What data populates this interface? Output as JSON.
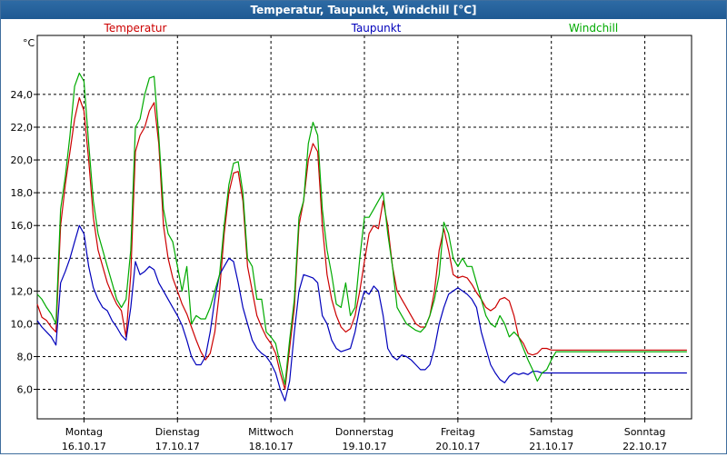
{
  "window": {
    "title": "Temperatur, Taupunkt, Windchill [°C]"
  },
  "chart_data": {
    "type": "line",
    "title": "Temperatur, Taupunkt, Windchill [°C]",
    "ylabel": "°C",
    "xlabel": "",
    "ylim": [
      4.2,
      27.6
    ],
    "xlim": [
      0,
      7
    ],
    "grid": true,
    "yticks": [
      6,
      8,
      10,
      12,
      14,
      16,
      18,
      20,
      22,
      24
    ],
    "ytick_labels": [
      "6,0",
      "8,0",
      "10,0",
      "12,0",
      "14,0",
      "16,0",
      "18,0",
      "20,0",
      "22,0",
      "24,0"
    ],
    "x_days": [
      {
        "day": "Montag",
        "date": "16.10.17"
      },
      {
        "day": "Dienstag",
        "date": "17.10.17"
      },
      {
        "day": "Mittwoch",
        "date": "18.10.17"
      },
      {
        "day": "Donnerstag",
        "date": "19.10.17"
      },
      {
        "day": "Freitag",
        "date": "20.10.17"
      },
      {
        "day": "Samstag",
        "date": "21.10.17"
      },
      {
        "day": "Sonntag",
        "date": "22.10.17"
      }
    ],
    "legend_placement": "top",
    "series": [
      {
        "name": "Temperatur",
        "color": "#cc0000",
        "x": [
          0,
          0.05,
          0.1,
          0.15,
          0.2,
          0.25,
          0.3,
          0.35,
          0.4,
          0.45,
          0.5,
          0.55,
          0.6,
          0.65,
          0.7,
          0.75,
          0.8,
          0.85,
          0.9,
          0.95,
          1,
          1.05,
          1.1,
          1.15,
          1.2,
          1.25,
          1.3,
          1.35,
          1.4,
          1.45,
          1.5,
          1.55,
          1.6,
          1.65,
          1.7,
          1.75,
          1.8,
          1.85,
          1.9,
          1.95,
          2,
          2.05,
          2.1,
          2.15,
          2.2,
          2.25,
          2.3,
          2.35,
          2.4,
          2.45,
          2.5,
          2.55,
          2.6,
          2.65,
          2.7,
          2.75,
          2.8,
          2.85,
          2.9,
          2.95,
          3,
          3.05,
          3.1,
          3.15,
          3.2,
          3.25,
          3.3,
          3.35,
          3.4,
          3.45,
          3.5,
          3.55,
          3.6,
          3.65,
          3.7,
          3.75,
          3.8,
          3.85,
          3.9,
          3.95,
          4,
          4.05,
          4.1,
          4.15,
          4.2,
          4.25,
          4.3,
          4.35,
          4.4,
          4.45,
          4.5,
          4.55,
          4.6,
          4.65,
          4.7,
          4.75,
          4.8,
          4.85,
          4.9,
          4.95,
          5,
          5.05,
          5.1,
          5.15,
          5.2,
          5.25,
          5.3,
          5.35,
          5.4,
          5.45,
          5.5,
          5.55,
          5.6,
          5.65,
          5.7,
          5.75,
          5.8,
          5.85,
          5.9,
          5.95,
          6,
          6.05,
          6.1,
          6.15,
          6.2,
          6.25,
          6.3,
          6.35,
          6.4,
          6.45,
          6.5,
          6.55,
          6.6,
          6.65,
          6.7,
          6.75,
          6.8,
          6.85,
          6.9,
          6.95
        ],
        "values": [
          11.2,
          10.4,
          10.2,
          9.8,
          9.5,
          16,
          18.5,
          20.5,
          22.5,
          23.8,
          23,
          20,
          16.5,
          14.5,
          13.5,
          12.5,
          11.8,
          11.2,
          10.8,
          9.2,
          13,
          20.5,
          21.5,
          22,
          23,
          23.5,
          21,
          16,
          14,
          12.8,
          12,
          11.2,
          10.6,
          9.8,
          9,
          8.3,
          7.8,
          8.2,
          9.5,
          12,
          15.5,
          18,
          19.2,
          19.3,
          17.5,
          13.5,
          12,
          10.5,
          9.8,
          9.2,
          8.8,
          8.2,
          7,
          6,
          8.5,
          11,
          16,
          17.5,
          20,
          21,
          20.5,
          16,
          13,
          11.5,
          10.5,
          9.8,
          9.5,
          9.7,
          10.5,
          12,
          13.8,
          15.5,
          16,
          15.8,
          17.5,
          16,
          13.5,
          12,
          11.5,
          11,
          10.5,
          10,
          9.8,
          9.8,
          10.5,
          12,
          14.5,
          15.8,
          14.5,
          13,
          12.8,
          12.9,
          12.8,
          12.4,
          11.9,
          11.5,
          11,
          10.8,
          11,
          11.5,
          11.6,
          11.4,
          10.5,
          9.2,
          8.8,
          8.2,
          8.1,
          8.2,
          8.5,
          8.5,
          8.4,
          8.4,
          8.4,
          8.4,
          8.4,
          8.4,
          8.4,
          8.4,
          8.4,
          8.4,
          8.4,
          8.4,
          8.4,
          8.4,
          8.4,
          8.4,
          8.4,
          8.4,
          8.4,
          8.4,
          8.4,
          8.4,
          8.4,
          8.4,
          8.4,
          8.4,
          8.4,
          8.4,
          8.4,
          8.4
        ]
      },
      {
        "name": "Taupunkt",
        "color": "#0000bb",
        "x": [
          0,
          0.05,
          0.1,
          0.15,
          0.2,
          0.25,
          0.3,
          0.35,
          0.4,
          0.45,
          0.5,
          0.55,
          0.6,
          0.65,
          0.7,
          0.75,
          0.8,
          0.85,
          0.9,
          0.95,
          1,
          1.05,
          1.1,
          1.15,
          1.2,
          1.25,
          1.3,
          1.35,
          1.4,
          1.45,
          1.5,
          1.55,
          1.6,
          1.65,
          1.7,
          1.75,
          1.8,
          1.85,
          1.9,
          1.95,
          2,
          2.05,
          2.1,
          2.15,
          2.2,
          2.25,
          2.3,
          2.35,
          2.4,
          2.45,
          2.5,
          2.55,
          2.6,
          2.65,
          2.7,
          2.75,
          2.8,
          2.85,
          2.9,
          2.95,
          3,
          3.05,
          3.1,
          3.15,
          3.2,
          3.25,
          3.3,
          3.35,
          3.4,
          3.45,
          3.5,
          3.55,
          3.6,
          3.65,
          3.7,
          3.75,
          3.8,
          3.85,
          3.9,
          3.95,
          4,
          4.05,
          4.1,
          4.15,
          4.2,
          4.25,
          4.3,
          4.35,
          4.4,
          4.45,
          4.5,
          4.55,
          4.6,
          4.65,
          4.7,
          4.75,
          4.8,
          4.85,
          4.9,
          4.95,
          5,
          5.05,
          5.1,
          5.15,
          5.2,
          5.25,
          5.3,
          5.35,
          5.4,
          5.45,
          5.5,
          5.55,
          5.6,
          5.65,
          5.7,
          5.75,
          5.8,
          5.85,
          5.9,
          5.95,
          6,
          6.05,
          6.1,
          6.15,
          6.2,
          6.25,
          6.3,
          6.35,
          6.4,
          6.45,
          6.5,
          6.55,
          6.6,
          6.65,
          6.7,
          6.75,
          6.8,
          6.85,
          6.9,
          6.95
        ],
        "values": [
          10.2,
          9.8,
          9.5,
          9.2,
          8.7,
          12.5,
          13.2,
          14,
          15,
          16,
          15.5,
          13.5,
          12.2,
          11.5,
          11,
          10.8,
          10.2,
          9.8,
          9.3,
          9,
          11,
          13.8,
          13,
          13.2,
          13.5,
          13.3,
          12.5,
          12,
          11.5,
          11,
          10.5,
          9.9,
          9,
          8,
          7.5,
          7.5,
          8,
          9.5,
          11.5,
          13,
          13.5,
          14,
          13.8,
          12.5,
          11,
          10,
          9,
          8.5,
          8.2,
          8,
          7.6,
          7,
          6,
          5.3,
          6.5,
          9.5,
          12,
          13,
          12.9,
          12.8,
          12.5,
          10.5,
          10,
          9,
          8.5,
          8.3,
          8.4,
          8.5,
          9.5,
          11,
          12,
          11.8,
          12.3,
          12,
          10.5,
          8.5,
          8,
          7.8,
          8.1,
          8,
          7.8,
          7.5,
          7.2,
          7.2,
          7.5,
          8.5,
          10,
          11,
          11.8,
          12,
          12.2,
          12,
          11.8,
          11.5,
          11,
          9.5,
          8.5,
          7.5,
          7,
          6.6,
          6.4,
          6.8,
          7,
          6.9,
          7,
          6.9,
          7.1,
          7.1,
          7,
          7,
          7,
          7,
          7,
          7,
          7,
          7,
          7,
          7,
          7,
          7,
          7,
          7,
          7,
          7,
          7,
          7,
          7,
          7,
          7,
          7,
          7,
          7,
          7,
          7,
          7,
          7,
          7,
          7,
          7,
          7
        ]
      },
      {
        "name": "Windchill",
        "color": "#00aa00",
        "x": [
          0,
          0.05,
          0.1,
          0.15,
          0.2,
          0.25,
          0.3,
          0.35,
          0.4,
          0.45,
          0.5,
          0.55,
          0.6,
          0.65,
          0.7,
          0.75,
          0.8,
          0.85,
          0.9,
          0.95,
          1,
          1.05,
          1.1,
          1.15,
          1.2,
          1.25,
          1.3,
          1.35,
          1.4,
          1.45,
          1.5,
          1.55,
          1.6,
          1.65,
          1.7,
          1.75,
          1.8,
          1.85,
          1.9,
          1.95,
          2,
          2.05,
          2.1,
          2.15,
          2.2,
          2.25,
          2.3,
          2.35,
          2.4,
          2.45,
          2.5,
          2.55,
          2.6,
          2.65,
          2.7,
          2.75,
          2.8,
          2.85,
          2.9,
          2.95,
          3,
          3.05,
          3.1,
          3.15,
          3.2,
          3.25,
          3.3,
          3.35,
          3.4,
          3.45,
          3.5,
          3.55,
          3.6,
          3.65,
          3.7,
          3.75,
          3.8,
          3.85,
          3.9,
          3.95,
          4,
          4.05,
          4.1,
          4.15,
          4.2,
          4.25,
          4.3,
          4.35,
          4.4,
          4.45,
          4.5,
          4.55,
          4.6,
          4.65,
          4.7,
          4.75,
          4.8,
          4.85,
          4.9,
          4.95,
          5,
          5.05,
          5.1,
          5.15,
          5.2,
          5.25,
          5.3,
          5.35,
          5.4,
          5.45,
          5.5,
          5.55,
          5.6,
          5.65,
          5.7,
          5.75,
          5.8,
          5.85,
          5.9,
          5.95,
          6,
          6.05,
          6.1,
          6.15,
          6.2,
          6.25,
          6.3,
          6.35,
          6.4,
          6.45,
          6.5,
          6.55,
          6.6,
          6.65,
          6.7,
          6.75,
          6.8,
          6.85,
          6.9,
          6.95
        ],
        "values": [
          11.8,
          11.5,
          11,
          10.6,
          10,
          17,
          19,
          21.5,
          24.5,
          25.3,
          24.8,
          21,
          17.5,
          15.5,
          14.5,
          13.5,
          12.5,
          11.5,
          11,
          11.5,
          14.5,
          22,
          22.5,
          24,
          25,
          25.1,
          21.5,
          17,
          15.5,
          15,
          13.5,
          12,
          13.5,
          10,
          10.5,
          10.3,
          10.3,
          11,
          12,
          13,
          16,
          18.5,
          19.8,
          19.9,
          18,
          14,
          13.5,
          11.5,
          11.5,
          9.5,
          9.2,
          8.8,
          7.5,
          6.3,
          9,
          11.5,
          16.5,
          17.5,
          21,
          22.3,
          21.5,
          17,
          14.5,
          13,
          11.2,
          11,
          12.5,
          10.5,
          11,
          14,
          16.5,
          16.5,
          17,
          17.5,
          18,
          15.5,
          13.5,
          11,
          10.5,
          10,
          9.8,
          9.6,
          9.5,
          9.8,
          10.5,
          11.5,
          13,
          16.2,
          15.5,
          14,
          13.5,
          14,
          13.5,
          13.5,
          12.5,
          11.5,
          10.5,
          10,
          9.8,
          10.5,
          10,
          9.2,
          9.5,
          9.2,
          8.5,
          7.8,
          7.2,
          6.5,
          7,
          7.2,
          7.8,
          8.3,
          8.3,
          8.3,
          8.3,
          8.3,
          8.3,
          8.3,
          8.3,
          8.3,
          8.3,
          8.3,
          8.3,
          8.3,
          8.3,
          8.3,
          8.3,
          8.3,
          8.3,
          8.3,
          8.3,
          8.3,
          8.3,
          8.3,
          8.3,
          8.3,
          8.3,
          8.3,
          8.3,
          8.3
        ]
      }
    ]
  }
}
